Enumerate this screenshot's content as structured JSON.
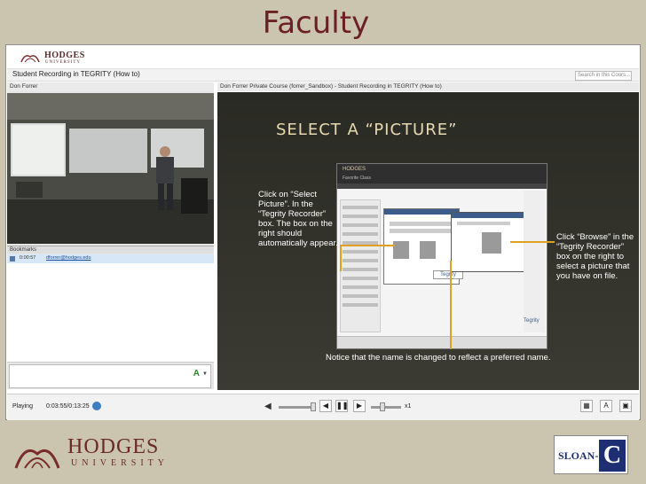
{
  "slide": {
    "title": "Faculty"
  },
  "app": {
    "logo_text": "HODGES",
    "logo_sub": "UNIVERSITY",
    "window_title": "Student Recording in TEGRITY (How to)",
    "search_placeholder": "Search in this Cours..."
  },
  "left_panel": {
    "presenter_name": "Don Forrer",
    "bookmarks_label": "Bookmarks",
    "bookmark_time": "0:00:57",
    "bookmark_link": "dforrer@hodges.edu"
  },
  "viewer": {
    "title": "Don Forrer Private Course (forrer_Sandbox) - Student Recording in TEGRITY (How to)",
    "heading": "SELECT A “PICTURE”",
    "callout_left": "Click on  “Select Picture”.  In the “Tegrity Recorder” box.  The box on the right should automatically appear.",
    "callout_right": "Click  “Browse” in the “Tegrity Recorder” box on the right to select a picture that you have on file.",
    "callout_bottom": "Notice that the name is changed to reflect a preferred name.",
    "embed_brand": "HODGES",
    "embed_sub": "Favorite Class",
    "embed_tegrity": "Tegrity"
  },
  "controls": {
    "status": "Playing",
    "time": "0:03:55/0:13:25",
    "speed": "x1"
  },
  "footer": {
    "logo_name": "HODGES",
    "logo_sub": "UNIVERSITY",
    "partner_text": "SLOAN-",
    "partner_mark": "C"
  },
  "colors": {
    "title": "#6b1f26",
    "band": "#cbc4ae",
    "callout_arrow": "#e0a020",
    "sloan_blue": "#1d2e73"
  },
  "playback_progress": 0.29
}
